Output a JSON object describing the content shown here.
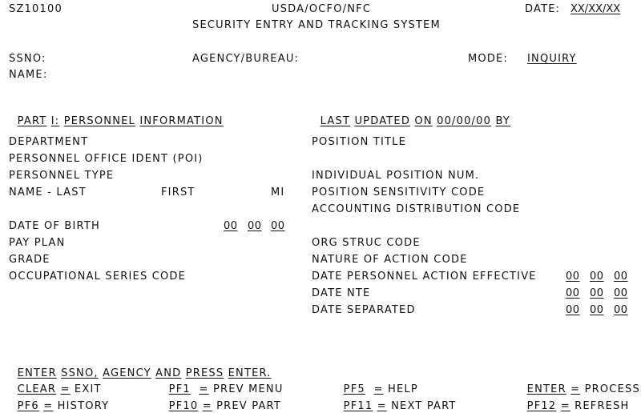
{
  "header": {
    "screen_id": "SZ10100",
    "org": "USDA/OCFO/NFC",
    "system_title": "SECURITY ENTRY AND TRACKING SYSTEM",
    "date_label": "DATE:",
    "date_value": "XX/XX/XX"
  },
  "key_fields": {
    "ssno_label": "SSNO:",
    "ssno_value": "",
    "agency_label": "AGENCY/BUREAU:",
    "agency_value": "",
    "mode_label": "MODE:",
    "mode_value": "INQUIRY",
    "name_label": "NAME:",
    "name_value": ""
  },
  "section": {
    "part_words": [
      "PART",
      "I:",
      "PERSONNEL",
      "INFORMATION"
    ],
    "last_updated_words": [
      "LAST",
      "UPDATED",
      "ON",
      "00/00/00",
      "BY"
    ]
  },
  "left_fields": {
    "department": "DEPARTMENT",
    "poi": "PERSONNEL OFFICE IDENT (POI)",
    "personnel_type": "PERSONNEL TYPE",
    "name_last": "NAME - LAST",
    "name_first": "FIRST",
    "name_mi": "MI",
    "date_of_birth": "DATE OF BIRTH",
    "dob_values": [
      "00",
      "00",
      "00"
    ],
    "pay_plan": "PAY PLAN",
    "grade": "GRADE",
    "occupational_series": "OCCUPATIONAL SERIES CODE"
  },
  "right_fields": {
    "position_title": "POSITION TITLE",
    "individual_position_num": "INDIVIDUAL POSITION NUM.",
    "position_sensitivity": "POSITION SENSITIVITY CODE",
    "accounting_distribution": "ACCOUNTING DISTRIBUTION CODE",
    "org_struc": "ORG STRUC CODE",
    "nature_of_action": "NATURE OF ACTION CODE",
    "date_action_effective": "DATE PERSONNEL ACTION EFFECTIVE",
    "date_action_effective_values": [
      "00",
      "00",
      "00"
    ],
    "date_nte": "DATE NTE",
    "date_nte_values": [
      "00",
      "00",
      "00"
    ],
    "date_separated": "DATE SEPARATED",
    "date_separated_values": [
      "00",
      "00",
      "00"
    ]
  },
  "footer": {
    "message_words": [
      "ENTER",
      "SSNO,",
      "AGENCY",
      "AND",
      "PRESS",
      "ENTER."
    ],
    "keys": [
      {
        "key": "CLEAR",
        "eq": "=",
        "action": "EXIT"
      },
      {
        "key": "PF1",
        "eq": "=",
        "action": "PREV MENU"
      },
      {
        "key": "PF5",
        "eq": "=",
        "action": "HELP"
      },
      {
        "key": "ENTER",
        "eq": "=",
        "action": "PROCESS"
      },
      {
        "key": "PF6",
        "eq": "=",
        "action": "HISTORY"
      },
      {
        "key": "PF10",
        "eq": "=",
        "action": "PREV PART"
      },
      {
        "key": "PF11",
        "eq": "=",
        "action": "NEXT PART"
      },
      {
        "key": "PF12",
        "eq": "=",
        "action": "REFRESH"
      }
    ]
  }
}
